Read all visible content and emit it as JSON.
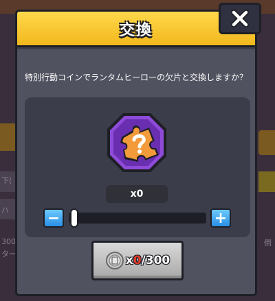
{
  "dialog": {
    "title": "交換",
    "prompt": "特別行動コインでランタムヒーローの欠片と交換しますか？"
  },
  "item": {
    "icon": "puzzle-piece-question-icon",
    "count_label": "x0"
  },
  "stepper": {
    "minus_label": "−",
    "plus_label": "+",
    "value": 0
  },
  "exchange_button": {
    "coin_icon": "special-action-coin-icon",
    "prefix": "x",
    "owned": "0",
    "required": "/300"
  },
  "background": {
    "left_text_1": "下(",
    "left_text_2": "ハ",
    "left_text_3": "300",
    "left_text_4": "ター",
    "right_text_1": "倒"
  },
  "colors": {
    "header": "#f2b81e",
    "body": "#50525f",
    "panel": "#3b3d4a",
    "stepper": "#2a8fe6",
    "tile": "#7a3fc8",
    "owned_count": "#e83a2a"
  }
}
